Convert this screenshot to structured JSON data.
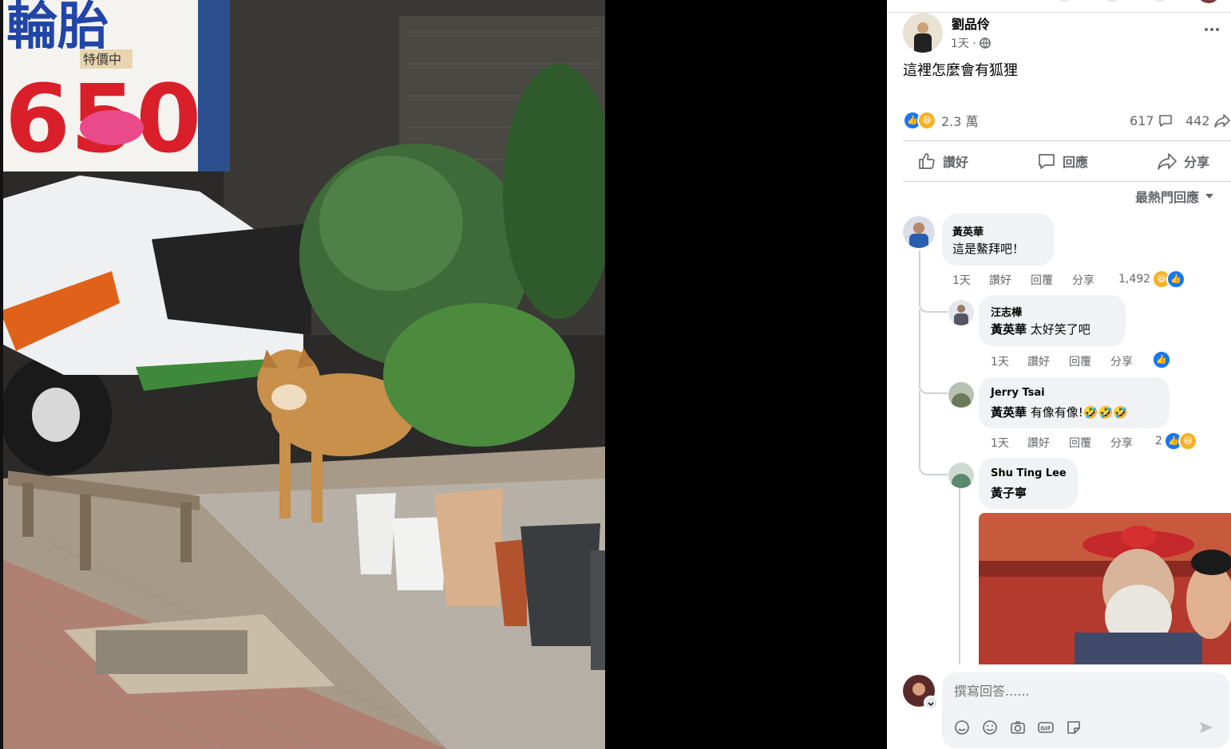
{
  "post": {
    "author": "劉品伶",
    "time": "1天 ·",
    "text": "這裡怎麼會有狐狸",
    "reactions_count": "2.3 萬",
    "comments_count": "617",
    "shares_count": "442"
  },
  "actions": {
    "like": "讚好",
    "comment": "回應",
    "share": "分享"
  },
  "sort_label": "最熱門回應",
  "comments": [
    {
      "name": "黃英華",
      "text": "這是鰲拜吧！",
      "time": "1天",
      "like": "讚好",
      "reply": "回覆",
      "share": "分享",
      "reaction_count": "1,492"
    },
    {
      "name": "汪志樺",
      "tag": "黃英華",
      "text": "太好笑了吧",
      "time": "1天",
      "like": "讚好",
      "reply": "回覆",
      "share": "分享"
    },
    {
      "name": "Jerry Tsai",
      "tag": "黃英華",
      "text": "有像有像!🤣🤣🤣",
      "time": "1天",
      "like": "讚好",
      "reply": "回覆",
      "share": "分享",
      "reaction_count": "2"
    },
    {
      "name": "Shu Ting Lee",
      "tag": "黃子寧"
    }
  ],
  "composer": {
    "placeholder": "撰寫回答......"
  },
  "photo": {
    "sign_big": "650",
    "sign_top": "輪胎",
    "sign_tag": "特價中"
  },
  "icons": [
    "more-icon",
    "globe-icon",
    "like-icon",
    "comment-icon",
    "share-icon",
    "chevron-down-icon",
    "sticker-icon",
    "emoji-icon",
    "camera-icon",
    "gif-icon",
    "sticker-alt-icon",
    "send-icon"
  ],
  "colors": {
    "accent": "#1877f2",
    "haha": "#f7b125",
    "bubble": "#f0f2f5",
    "secondary_text": "#65676b"
  }
}
